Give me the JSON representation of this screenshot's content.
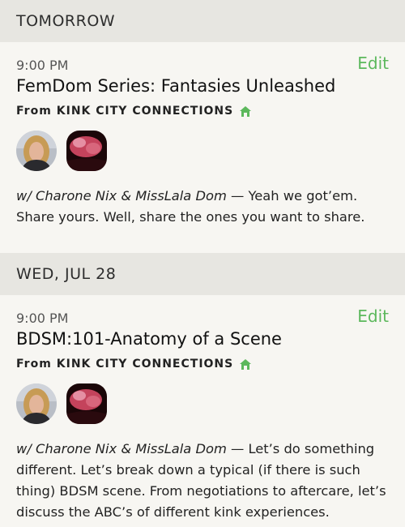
{
  "sections": [
    {
      "header": "TOMORROW",
      "event": {
        "time": "9:00 PM",
        "edit_label": "Edit",
        "title": "FemDom Series: Fantasies Unleashed",
        "from_prefix": "From",
        "organizer": "KINK CITY CONNECTIONS",
        "people": "w/ Charone Nix & MissLala Dom",
        "description": " — Yeah we got’em. Share yours.  Well, share the ones you want to share."
      }
    },
    {
      "header": "WED, JUL 28",
      "event": {
        "time": "9:00 PM",
        "edit_label": "Edit",
        "title": "BDSM:101-Anatomy of a Scene",
        "from_prefix": "From",
        "organizer": "KINK CITY CONNECTIONS",
        "people": "w/ Charone Nix & MissLala Dom",
        "description": " — Let’s do something different. Let’s break down a typical (if there is such thing) BDSM scene. From negotiations to aftercare, let’s discuss the ABC’s of different kink experiences."
      }
    }
  ],
  "colors": {
    "accent": "#5cb85c",
    "header_bg": "#e7e6e1",
    "page_bg": "#f7f6f2"
  },
  "icons": {
    "organizer_badge": "house-icon"
  }
}
